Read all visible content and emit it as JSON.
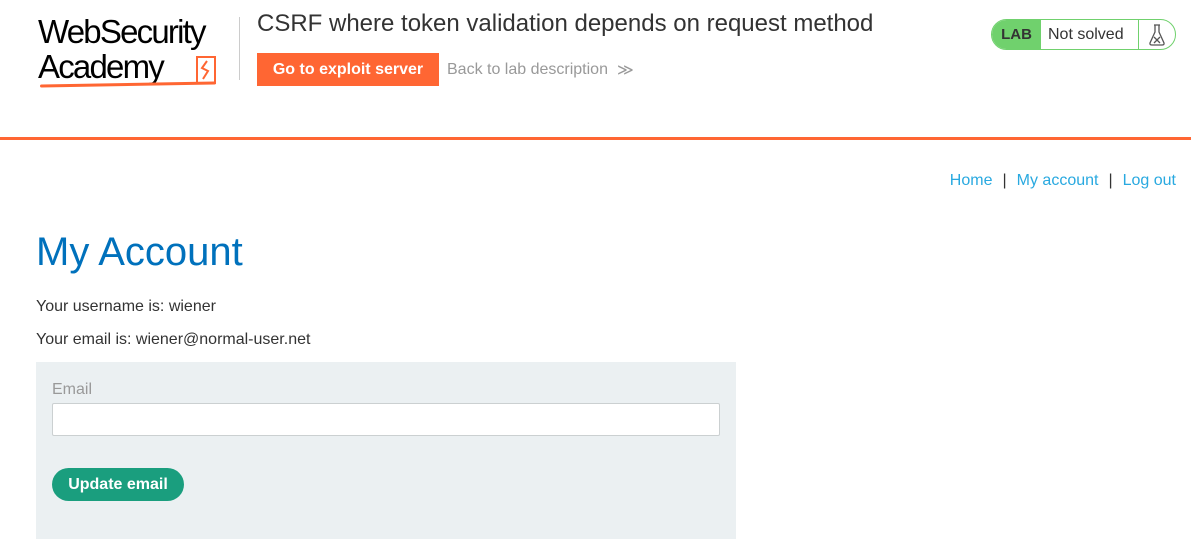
{
  "logo": {
    "line1": "WebSecurity",
    "line2": "Academy"
  },
  "header": {
    "title": "CSRF where token validation depends on request method",
    "exploit_button": "Go to exploit server",
    "back_link": "Back to lab description",
    "back_chevron": "≫",
    "badge_tag": "LAB",
    "badge_status": "Not solved"
  },
  "nav": {
    "home": "Home",
    "my_account": "My account",
    "logout": "Log out",
    "separator": "|"
  },
  "main": {
    "title": "My Account",
    "username_line": "Your username is: wiener",
    "email_line": "Your email is: wiener@normal-user.net",
    "email_label": "Email",
    "email_value": "",
    "update_button": "Update email"
  },
  "colors": {
    "accent": "#ff6633",
    "link": "#29a9e0",
    "heading": "#0071bc",
    "success": "#70d16d",
    "button": "#1a9e7e",
    "panel": "#ebf0f2"
  }
}
